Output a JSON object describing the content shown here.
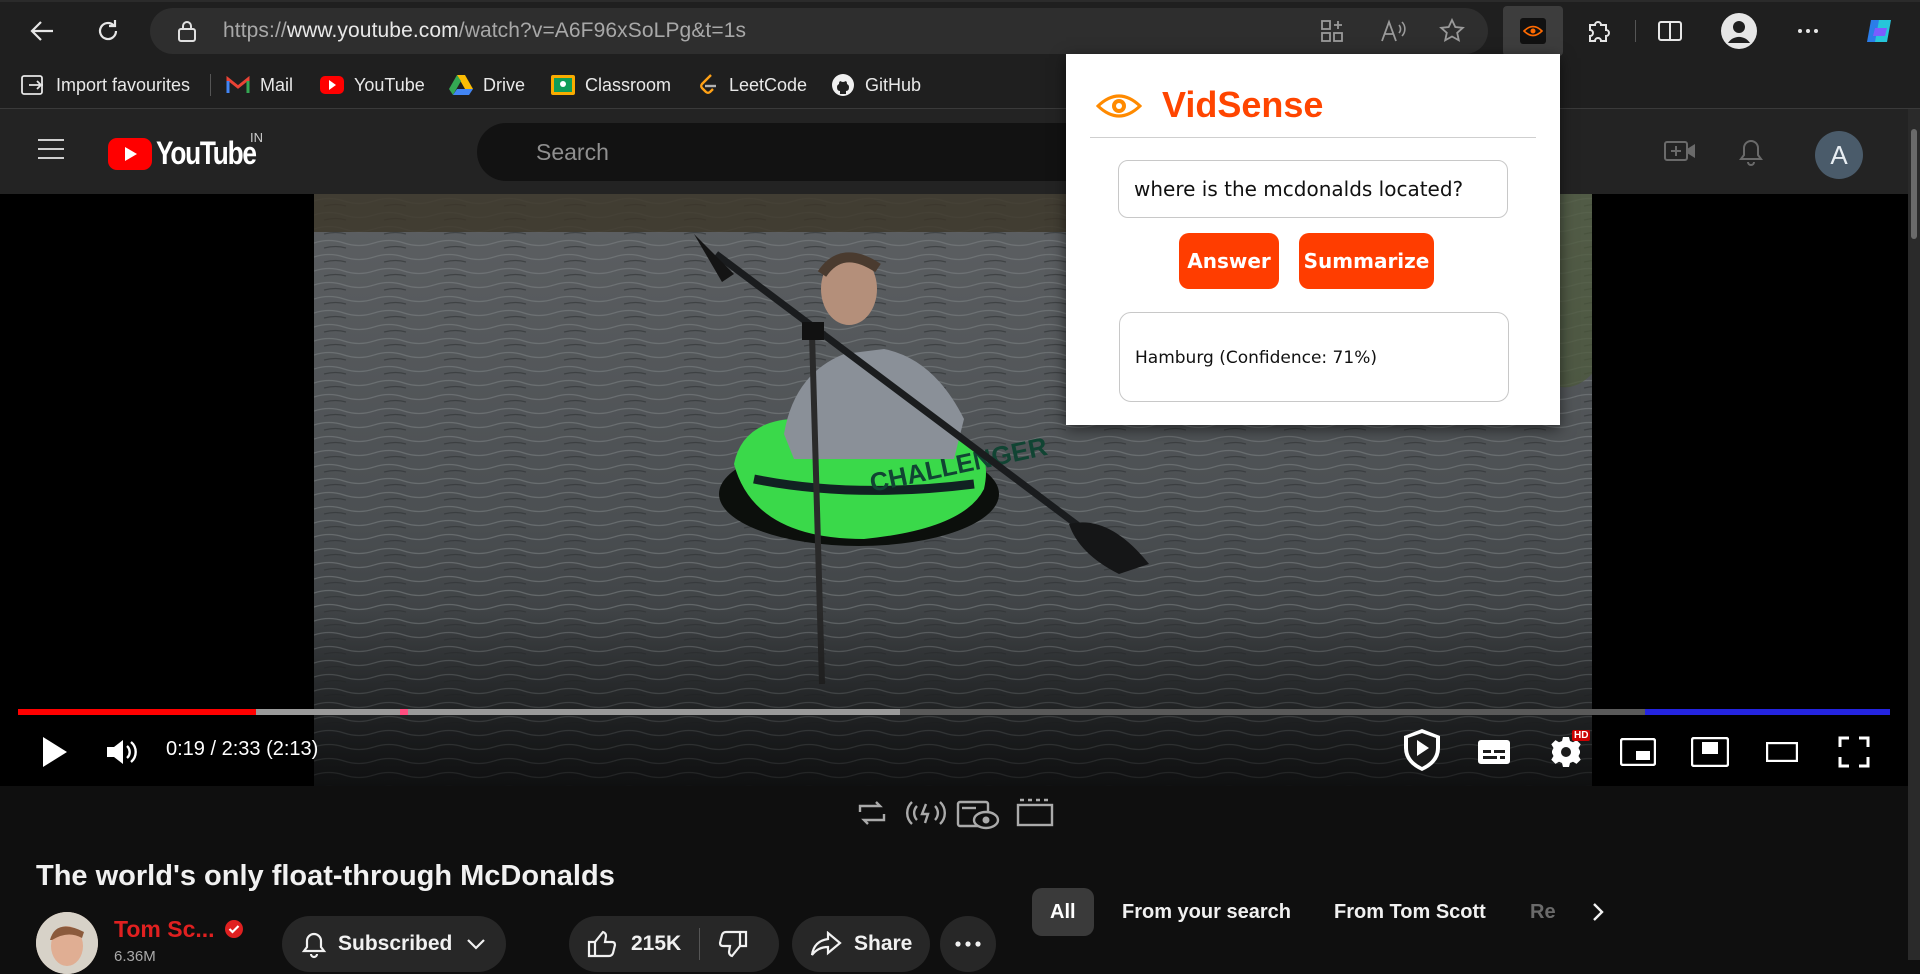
{
  "browser": {
    "url_prefix": "https://",
    "url_host": "www.youtube.com",
    "url_path": "/watch?v=A6F96xSoLPg&t=1s"
  },
  "bookmarks": [
    {
      "label": "Import favourites",
      "icon": "import-icon"
    },
    {
      "label": "Mail",
      "icon": "gmail-icon"
    },
    {
      "label": "YouTube",
      "icon": "youtube-icon"
    },
    {
      "label": "Drive",
      "icon": "drive-icon"
    },
    {
      "label": "Classroom",
      "icon": "classroom-icon"
    },
    {
      "label": "LeetCode",
      "icon": "leetcode-icon"
    },
    {
      "label": "GitHub",
      "icon": "github-icon"
    }
  ],
  "youtube": {
    "logo_text": "YouTube",
    "region": "IN",
    "search_placeholder": "Search",
    "avatar_letter": "A"
  },
  "player": {
    "time": "0:19 / 2:33 (2:13)",
    "played_fraction": 0.127,
    "buffered_fraction": 0.471,
    "quality_badge": "HD"
  },
  "video": {
    "title": "The world's only float-through McDonalds",
    "channel": "Tom Sc...",
    "subscribers": "6.36M",
    "subscribed_label": "Subscribed",
    "likes": "215K",
    "share_label": "Share"
  },
  "chips": [
    "All",
    "From your search",
    "From Tom Scott",
    "Re"
  ],
  "extension": {
    "name": "VidSense",
    "question": "where is the mcdonalds located?",
    "answer_button": "Answer",
    "summarize_button": "Summarize",
    "result": "Hamburg (Confidence: 71%)"
  },
  "colors": {
    "accent": "#ff4500",
    "youtube_red": "#ff0000",
    "chrome_bg": "#1f1f1f"
  }
}
